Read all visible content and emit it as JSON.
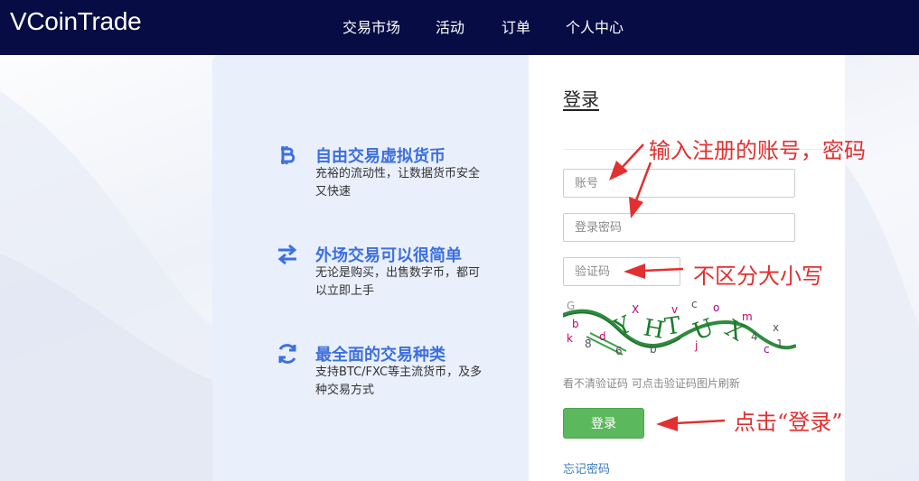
{
  "app": {
    "brand": "VCoinTrade"
  },
  "nav": [
    "交易市场",
    "活动",
    "订单",
    "个人中心"
  ],
  "features": [
    {
      "icon": "bitcoin-icon",
      "title": "自由交易虚拟货币",
      "desc": "充裕的流动性，让数据货币安全又快速"
    },
    {
      "icon": "transfer-icon",
      "title": "外场交易可以很简单",
      "desc": "无论是购买，出售数字币，都可以立即上手"
    },
    {
      "icon": "refresh-icon",
      "title": "最全面的交易种类",
      "desc": "支持BTC/FXC等主流货币，及多种交易方式"
    }
  ],
  "login": {
    "title": "登录",
    "account_placeholder": "账号",
    "password_placeholder": "登录密码",
    "captcha_placeholder": "验证码",
    "captcha_hint": "看不清验证码 可点击验证码图片刷新",
    "submit_label": "登录",
    "forgot_label": "忘记密码"
  },
  "annotations": {
    "account": "输入注册的账号，密码",
    "captcha": "不区分大小写",
    "submit": "点击“登录”"
  },
  "colors": {
    "topbar": "#070d44",
    "accent_blue": "#3d6fe0",
    "login_button": "#5cb85c",
    "annotation_red": "#e23030",
    "link": "#3a7bc0"
  }
}
